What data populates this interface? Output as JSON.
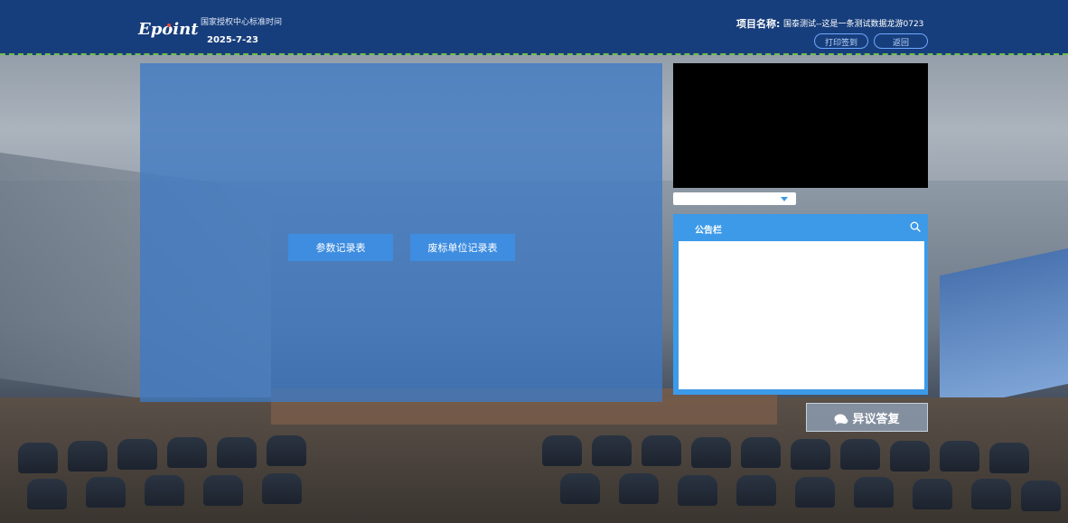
{
  "header": {
    "logo_text": "Epoint",
    "time_label": "国家授权中心标准时间",
    "date": "2025-7-23",
    "project_label": "项目名称:",
    "project_name": "国泰测试--这是一条测试数据龙游0723",
    "print_sign_button": "打印签到",
    "back_button": "返回"
  },
  "main": {
    "param_record_button": "参数记录表",
    "void_bidder_button": "废标单位记录表"
  },
  "sidebar": {
    "select_value": "",
    "notice_title": "公告栏",
    "objection_button": "异议答复"
  },
  "colors": {
    "header_bg": "#173e7c",
    "panel_blue": "#3f7ac4",
    "button_blue": "#3e8de0",
    "notice_blue": "#3c9ae8",
    "header_dash": "#6fbf4a"
  },
  "icons": [
    "search-icon",
    "chat-icon",
    "dropdown-arrow-icon"
  ]
}
